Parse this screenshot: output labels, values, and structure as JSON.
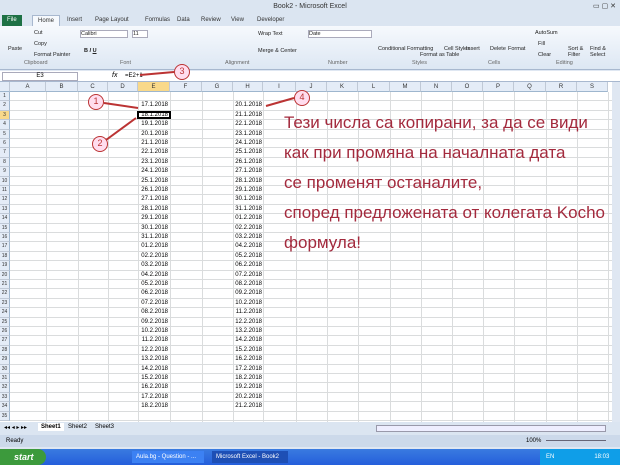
{
  "window": {
    "title": "Book2 - Microsoft Excel"
  },
  "tabs": [
    "File",
    "Home",
    "Insert",
    "Page Layout",
    "Formulas",
    "Data",
    "Review",
    "View",
    "Developer"
  ],
  "ribbon": {
    "paste": "Paste",
    "cut": "Cut",
    "copy": "Copy",
    "format_painter": "Format Painter",
    "font_name": "Calibri",
    "font_size": "11",
    "wrap_text": "Wrap Text",
    "merge_center": "Merge & Center",
    "number_format": "Date",
    "conditional": "Conditional Formatting",
    "format_table": "Format as Table",
    "cell_styles": "Cell Styles",
    "insert": "Insert",
    "delete": "Delete",
    "format": "Format",
    "autosum": "AutoSum",
    "fill": "Fill",
    "clear": "Clear",
    "sort_filter": "Sort & Filter",
    "find_select": "Find & Select",
    "groups": [
      "Clipboard",
      "Font",
      "Alignment",
      "Number",
      "Styles",
      "Cells",
      "Editing"
    ]
  },
  "formula_bar": {
    "name_box": "E3",
    "fx": "fx",
    "formula": "=E2+1"
  },
  "columns": [
    "A",
    "B",
    "C",
    "D",
    "E",
    "F",
    "G",
    "H",
    "I",
    "J",
    "K",
    "L",
    "M",
    "N",
    "O",
    "P",
    "Q",
    "R",
    "S"
  ],
  "colE": [
    "17.1.2018",
    "18.1.2018",
    "19.1.2018",
    "20.1.2018",
    "21.1.2018",
    "22.1.2018",
    "23.1.2018",
    "24.1.2018",
    "25.1.2018",
    "26.1.2018",
    "27.1.2018",
    "28.1.2018",
    "29.1.2018",
    "30.1.2018",
    "31.1.2018",
    "01.2.2018",
    "02.2.2018",
    "03.2.2018",
    "04.2.2018",
    "05.2.2018",
    "06.2.2018",
    "07.2.2018",
    "08.2.2018",
    "09.2.2018",
    "10.2.2018",
    "11.2.2018",
    "12.2.2018",
    "13.2.2018",
    "14.2.2018",
    "15.2.2018",
    "16.2.2018",
    "17.2.2018",
    "18.2.2018"
  ],
  "colH": [
    "20.1.2018",
    "21.1.2018",
    "22.1.2018",
    "23.1.2018",
    "24.1.2018",
    "25.1.2018",
    "26.1.2018",
    "27.1.2018",
    "28.1.2018",
    "29.1.2018",
    "30.1.2018",
    "31.1.2018",
    "01.2.2018",
    "02.2.2018",
    "03.2.2018",
    "04.2.2018",
    "05.2.2018",
    "06.2.2018",
    "07.2.2018",
    "08.2.2018",
    "09.2.2018",
    "10.2.2018",
    "11.2.2018",
    "12.2.2018",
    "13.2.2018",
    "14.2.2018",
    "15.2.2018",
    "16.2.2018",
    "17.2.2018",
    "18.2.2018",
    "19.2.2018",
    "20.2.2018",
    "21.2.2018"
  ],
  "note": [
    "Тези числа са копирани, за да се види",
    "как при промяна на началната дата",
    "се променят останалите,",
    "според предложената от колегата Kocho",
    "формула!"
  ],
  "markers": [
    "1",
    "2",
    "3",
    "4"
  ],
  "sheets": [
    "Sheet1",
    "Sheet2",
    "Sheet3"
  ],
  "status": {
    "ready": "Ready",
    "zoom": "100%"
  },
  "taskbar": {
    "start": "start",
    "items": [
      "Aula.bg - Question - ...",
      "Microsoft Excel - Book2"
    ],
    "lang": "EN",
    "time": "18:03"
  },
  "accent": "#1e7145"
}
